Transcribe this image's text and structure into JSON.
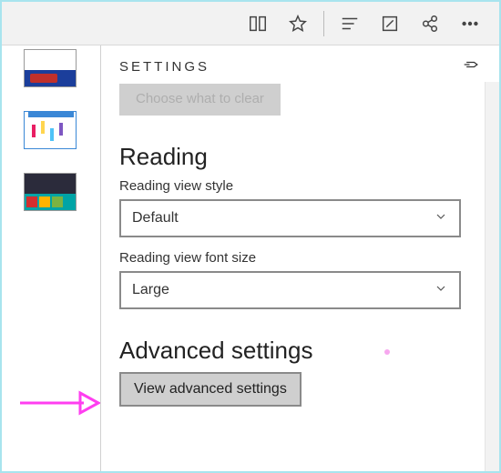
{
  "panel": {
    "title": "SETTINGS",
    "ghost_button": "Choose what to clear",
    "reading": {
      "heading": "Reading",
      "style_label": "Reading view style",
      "style_value": "Default",
      "font_label": "Reading view font size",
      "font_value": "Large"
    },
    "advanced": {
      "heading": "Advanced settings",
      "button": "View advanced settings"
    }
  }
}
